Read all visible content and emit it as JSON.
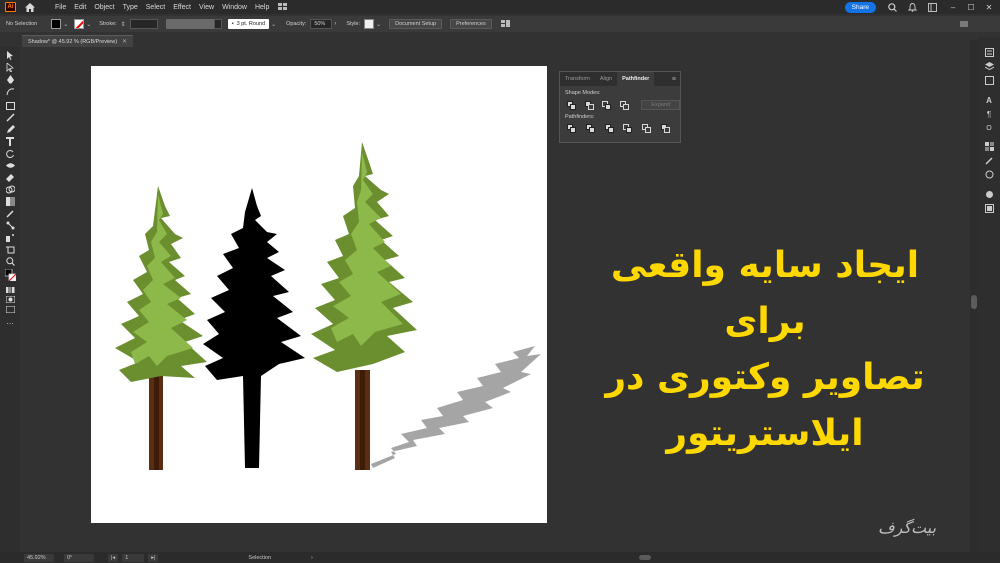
{
  "app": {
    "logo_text": "Ai",
    "menu": [
      "File",
      "Edit",
      "Object",
      "Type",
      "Select",
      "Effect",
      "View",
      "Window",
      "Help"
    ],
    "share_label": "Share",
    "icons": [
      "home-icon",
      "search-icon",
      "notifications-icon",
      "workspace-icon",
      "arrange-icon"
    ]
  },
  "control_bar": {
    "selection_label": "No Selection",
    "stroke_label": "Stroke:",
    "brush_label": "3 pt. Round",
    "opacity_label": "Opacity:",
    "opacity_value": "50%",
    "style_label": "Style:",
    "document_setup_label": "Document Setup",
    "preferences_label": "Preferences"
  },
  "document_tab": {
    "title": "Shadow* @ 45.92 % (RGB/Preview)"
  },
  "pathfinder_panel": {
    "tabs": [
      "Transform",
      "Align",
      "Pathfinder"
    ],
    "active_tab": "Pathfinder",
    "shape_modes_label": "Shape Modes:",
    "pathfinders_label": "Pathfinders:",
    "expand_label": "Expand"
  },
  "overlay_title": {
    "lines": [
      "ایجاد سایه واقعی برای",
      "تصاویر وکتوری در",
      "ایلاستریتور"
    ],
    "color": "#ffd800"
  },
  "watermark": "بیت‌گرف",
  "status_bar": {
    "zoom": "45.92%",
    "rotation": "0°",
    "artboard_number": "1",
    "current_tool": "Selection"
  },
  "colors": {
    "ui_background": "#323232",
    "share_blue": "#1473e6",
    "tree_green": "#6b8e2f",
    "tree_light_green": "#8db84a",
    "trunk_brown": "#5a2e12",
    "shadow_gray": "#a5a5a5"
  }
}
